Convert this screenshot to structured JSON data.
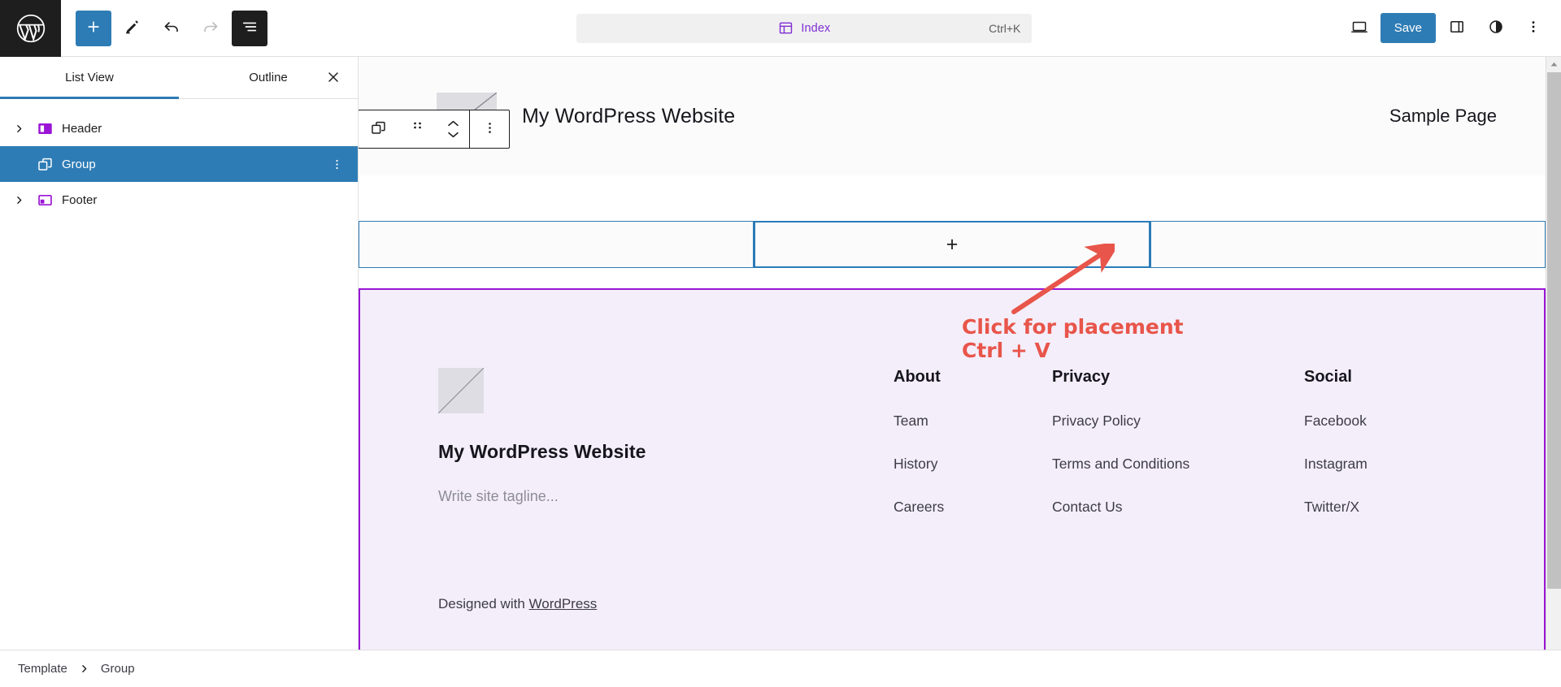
{
  "topbar": {
    "logo_icon": "wordpress-logo-icon",
    "tools": [
      {
        "name": "block-inserter-button",
        "icon": "plus-icon",
        "style": "primary"
      },
      {
        "name": "tools-edit-button",
        "icon": "pencil-icon",
        "style": "plain"
      },
      {
        "name": "undo-button",
        "icon": "undo-arrow-icon",
        "style": "plain"
      },
      {
        "name": "redo-button",
        "icon": "redo-arrow-icon",
        "style": "disabled"
      },
      {
        "name": "list-view-button",
        "icon": "list-view-icon",
        "style": "dark"
      }
    ],
    "command_bar": {
      "icon": "template-index-icon",
      "label": "Index",
      "shortcut": "Ctrl+K",
      "accent_color": "#7f2ed4"
    },
    "view_button_icon": "desktop-preview-icon",
    "save_label": "Save",
    "save_color": "#2e7cb5",
    "settings_icon": "sidebar-settings-icon",
    "styles_icon": "styles-contrast-icon",
    "options_icon": "vertical-ellipsis-icon"
  },
  "sidebar": {
    "tabs": [
      {
        "label": "List View",
        "active": true
      },
      {
        "label": "Outline",
        "active": false
      }
    ],
    "close_icon": "close-x-icon",
    "active_accent": "#2e7cb5",
    "items": [
      {
        "label": "Header",
        "icon": "header-block-icon",
        "expandable": true,
        "selected": false
      },
      {
        "label": "Group",
        "icon": "group-block-icon",
        "expandable": false,
        "selected": true,
        "more_icon": "vertical-ellipsis-icon"
      },
      {
        "label": "Footer",
        "icon": "footer-block-icon",
        "expandable": true,
        "selected": false
      }
    ]
  },
  "block_toolbar": {
    "block_icon": "group-block-icon",
    "drag_icon": "drag-handle-icon",
    "move_up_icon": "chevron-up-icon",
    "move_down_icon": "chevron-down-icon",
    "options_icon": "vertical-ellipsis-icon"
  },
  "canvas": {
    "site_header": {
      "logo_icon": "site-logo-placeholder",
      "title": "My WordPress Website",
      "nav_link": "Sample Page"
    },
    "columns_block": {
      "border_color": "#2e7cb5",
      "columns": [
        {
          "name": "column-left",
          "active": false,
          "appender": ""
        },
        {
          "name": "column-center",
          "active": true,
          "appender": "+"
        },
        {
          "name": "column-right",
          "active": false,
          "appender": ""
        }
      ]
    },
    "annotation": {
      "line1": "Click for placement",
      "line2": "Ctrl + V",
      "color": "#e8554a",
      "arrow": "red-arrow-pointing-up-right"
    },
    "footer_block": {
      "border_color": "#9a15d6",
      "background": "#f4eefb",
      "logo_icon": "site-logo-placeholder",
      "site_name": "My WordPress Website",
      "tagline_placeholder": "Write site tagline...",
      "credit_prefix": "Designed with ",
      "credit_link": "WordPress",
      "link_columns": [
        {
          "heading": "About",
          "links": [
            "Team",
            "History",
            "Careers"
          ]
        },
        {
          "heading": "Privacy",
          "links": [
            "Privacy Policy",
            "Terms and Conditions",
            "Contact Us"
          ]
        },
        {
          "heading": "Social",
          "links": [
            "Facebook",
            "Instagram",
            "Twitter/X"
          ]
        }
      ]
    }
  },
  "statusbar": {
    "breadcrumb": [
      "Template",
      "Group"
    ],
    "separator_icon": "chevron-right-icon"
  }
}
